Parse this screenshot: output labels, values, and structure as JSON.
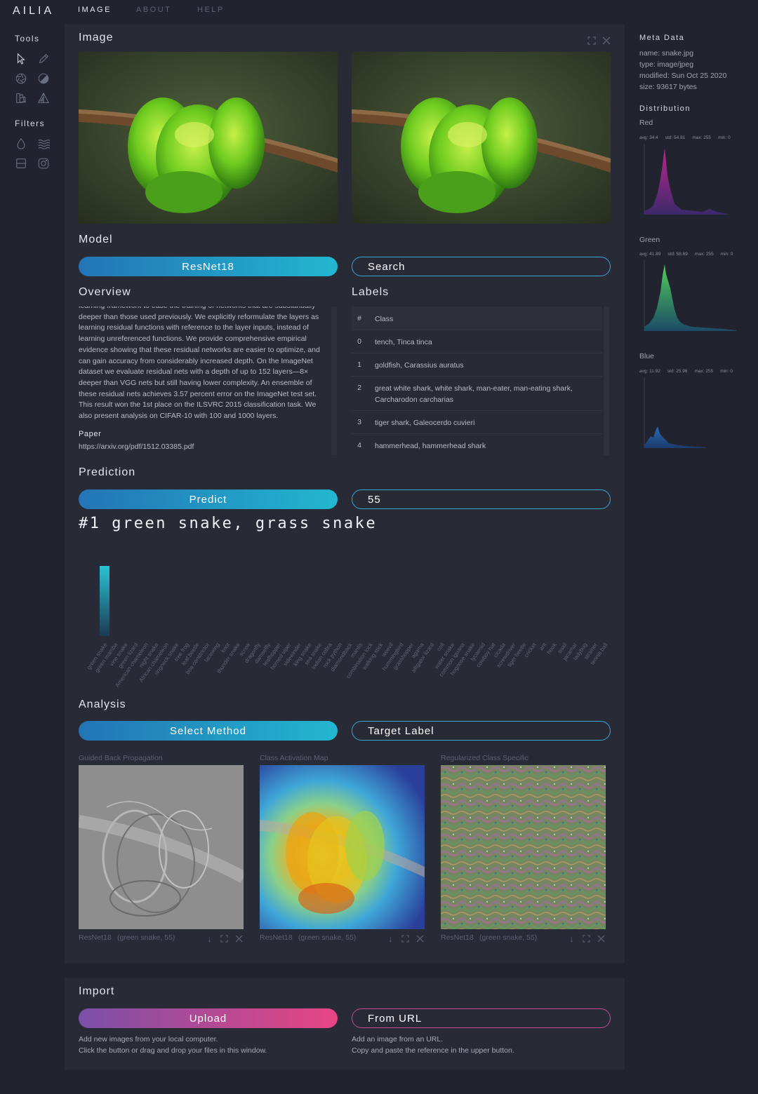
{
  "nav": {
    "logo": "AILIA",
    "links": [
      "IMAGE",
      "ABOUT",
      "HELP"
    ]
  },
  "sidebar": {
    "tools_title": "Tools",
    "tools": [
      "pointer-icon",
      "eyedropper-icon",
      "aperture-icon",
      "contrast-icon",
      "color-swatches-icon",
      "triangle-ruler-icon"
    ],
    "filters_title": "Filters",
    "filters": [
      "drop-icon",
      "waves-icon",
      "split-frame-icon",
      "instagram-icon"
    ]
  },
  "image_section": {
    "title": "Image"
  },
  "model": {
    "title": "Model",
    "selected": "ResNet18",
    "search_placeholder": "Search"
  },
  "overview": {
    "title": "Overview",
    "text": "learning framework to ease the training of networks that are substantially deeper than those used previously. We explicitly reformulate the layers as learning residual functions with reference to the layer inputs, instead of learning unreferenced functions. We provide comprehensive empirical evidence showing that these residual networks are easier to optimize, and can gain accuracy from considerably increased depth. On the ImageNet dataset we evaluate residual nets with a depth of up to 152 layers—8× deeper than VGG nets but still having lower complexity. An ensemble of these residual nets achieves 3.57 percent error on the ImageNet test set. This result won the 1st place on the ILSVRC 2015 classification task. We also present analysis on CIFAR-10 with 100 and 1000 layers.",
    "paper_label": "Paper",
    "paper_url": "https://arxiv.org/pdf/1512.03385.pdf"
  },
  "labels": {
    "title": "Labels",
    "header": {
      "num": "#",
      "cls": "Class"
    },
    "rows": [
      {
        "num": "0",
        "cls": "tench, Tinca tinca"
      },
      {
        "num": "1",
        "cls": "goldfish, Carassius auratus"
      },
      {
        "num": "2",
        "cls": "great white shark, white shark, man-eater, man-eating shark, Carcharodon carcharias"
      },
      {
        "num": "3",
        "cls": "tiger shark, Galeocerdo cuvieri"
      },
      {
        "num": "4",
        "cls": "hammerhead, hammerhead shark"
      }
    ]
  },
  "prediction": {
    "title": "Prediction",
    "button": "Predict",
    "value": "55",
    "result": "#1 green snake, grass snake"
  },
  "chart_data": {
    "type": "bar",
    "categories": [
      "green snake",
      "green mamba",
      "vine snake",
      "green lizard",
      "American chameleon",
      "night snake",
      "African chameleon",
      "ringneck snake",
      "tree frog",
      "leaf beetle",
      "boa constrictor",
      "lacewing",
      "knot",
      "thunder snake",
      "screw",
      "dragonfly",
      "damselfly",
      "leafhopper",
      "horned viper",
      "sidewinder",
      "king snake",
      "sea snake",
      "Indian cobra",
      "rock python",
      "diamondback",
      "mantis",
      "combination lock",
      "walking stick",
      "weevil",
      "hummingbird",
      "grasshopper",
      "agama",
      "alligator lizard",
      "coil",
      "water snake",
      "common iguana",
      "hognose snake",
      "lycaenid",
      "cowboy hat",
      "cicada",
      "screwdriver",
      "tiger beetle",
      "cricket",
      "ant",
      "hook",
      "snail",
      "jacamar",
      "ladybug",
      "strainer",
      "tennis ball"
    ],
    "values": [
      1.0,
      0.0,
      0.0,
      0.0,
      0.0,
      0.0,
      0.0,
      0.0,
      0.0,
      0.0,
      0.0,
      0.0,
      0.0,
      0.0,
      0.0,
      0.0,
      0.0,
      0.0,
      0.0,
      0.0,
      0.0,
      0.0,
      0.0,
      0.0,
      0.0,
      0.0,
      0.0,
      0.0,
      0.0,
      0.0,
      0.0,
      0.0,
      0.0,
      0.0,
      0.0,
      0.0,
      0.0,
      0.0,
      0.0,
      0.0,
      0.0,
      0.0,
      0.0,
      0.0,
      0.0,
      0.0,
      0.0,
      0.0,
      0.0,
      0.0
    ],
    "ylim": [
      0,
      1
    ],
    "colors": {
      "top": "#29c3d6",
      "bottom": "#1b3a52"
    }
  },
  "analysis": {
    "title": "Analysis",
    "method_button": "Select Method",
    "target_label": "Target Label",
    "cards": [
      {
        "title": "Guided Back Propagation",
        "model": "ResNet18",
        "label": "(green snake, 55)"
      },
      {
        "title": "Class Activation Map",
        "model": "ResNet18",
        "label": "(green snake, 55)"
      },
      {
        "title": "Regularized Class Specific",
        "model": "ResNet18",
        "label": "(green snake, 55)"
      }
    ]
  },
  "import": {
    "title": "Import",
    "upload_button": "Upload",
    "url_button": "From URL",
    "upload_desc_1": "Add new images from your local computer.",
    "upload_desc_2": "Click the button or drag and drop your files in this window.",
    "url_desc_1": "Add an image from an URL.",
    "url_desc_2": "Copy and paste the reference in the upper button."
  },
  "meta": {
    "title": "Meta Data",
    "name": "name: snake.jpg",
    "type": "type: image/jpeg",
    "modified": "modified: Sun Oct 25 2020",
    "size": "size: 93617 bytes"
  },
  "distribution": {
    "title": "Distribution",
    "channels": [
      {
        "name": "Red",
        "avg": "avg: 34.4",
        "std": "std: 54.81",
        "max": "max: 255",
        "min": "min: 0",
        "color_top": "#c0258f",
        "color_bottom": "#3b2a6b"
      },
      {
        "name": "Green",
        "avg": "avg: 41.89",
        "std": "std: 58.69",
        "max": "max: 255",
        "min": "min: 0",
        "color_top": "#4fcf5b",
        "color_bottom": "#1d4a66"
      },
      {
        "name": "Blue",
        "avg": "avg: 11.92",
        "std": "std: 25.96",
        "max": "max: 255",
        "min": "min: 0",
        "color_top": "#2a6bb8",
        "color_bottom": "#1c3a6a"
      }
    ]
  }
}
